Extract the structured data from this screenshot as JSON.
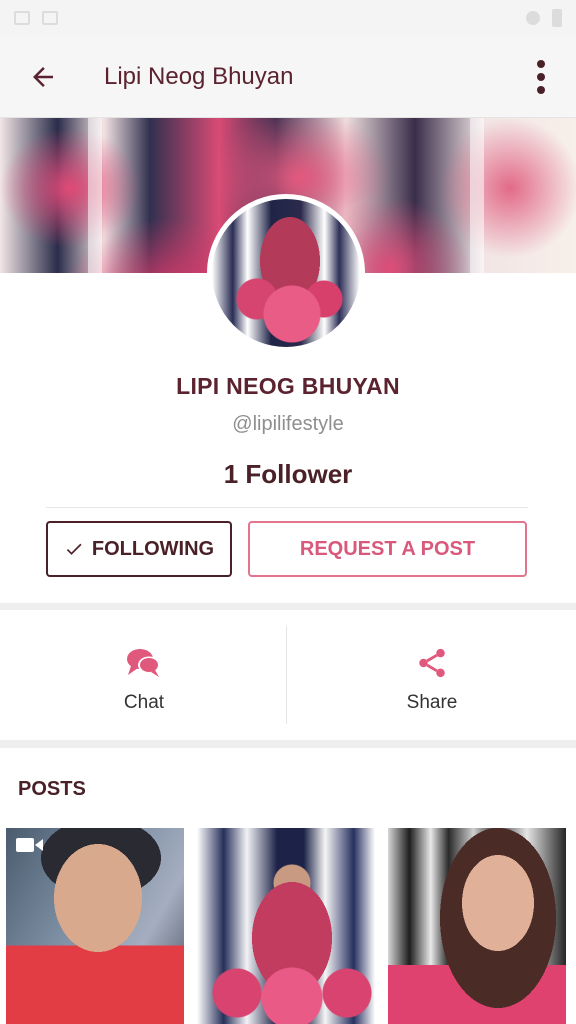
{
  "app_bar": {
    "title": "Lipi Neog Bhuyan"
  },
  "profile": {
    "name": "LIPI NEOG BHUYAN",
    "handle": "@lipilifestyle",
    "followers": "1 Follower",
    "following_label": "FOLLOWING",
    "request_label": "REQUEST A POST"
  },
  "actions": {
    "chat_label": "Chat",
    "share_label": "Share"
  },
  "posts": {
    "heading": "POSTS"
  },
  "colors": {
    "brand_dark": "#4a2128",
    "accent_pink": "#d9597d",
    "title_color": "#5b2330"
  },
  "icons": [
    "back-arrow-icon",
    "more-vert-icon",
    "check-icon",
    "chat-icon",
    "share-icon",
    "video-icon"
  ]
}
